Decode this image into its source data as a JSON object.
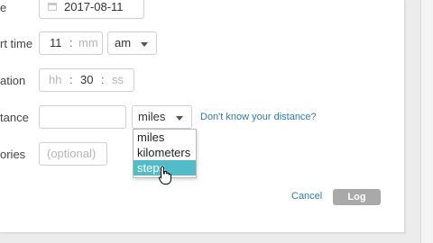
{
  "form": {
    "date": {
      "label": "e",
      "value": "2017-08-11",
      "icon": "calendar-icon"
    },
    "start_time": {
      "label": "rt time",
      "hour": "11",
      "separator": ":",
      "minute_placeholder": "mm",
      "ampm_value": "am"
    },
    "duration": {
      "label": "ation",
      "hours_placeholder": "hh",
      "minutes": "30",
      "seconds_placeholder": "ss",
      "separator1": ":",
      "separator2": ":"
    },
    "distance": {
      "label": "tance",
      "value": "",
      "unit_value": "miles",
      "help_link": "Don't know your distance?",
      "unit_options": [
        {
          "label": "miles"
        },
        {
          "label": "kilometers"
        },
        {
          "label": "steps"
        }
      ],
      "highlighted_option": "steps"
    },
    "calories": {
      "label": "ories",
      "placeholder": "(optional)"
    }
  },
  "actions": {
    "cancel_label": "Cancel",
    "log_label": "Log"
  },
  "colors": {
    "link": "#2a7bb6",
    "highlight": "#4fbcc8",
    "log_button": "#a9a9a9"
  }
}
